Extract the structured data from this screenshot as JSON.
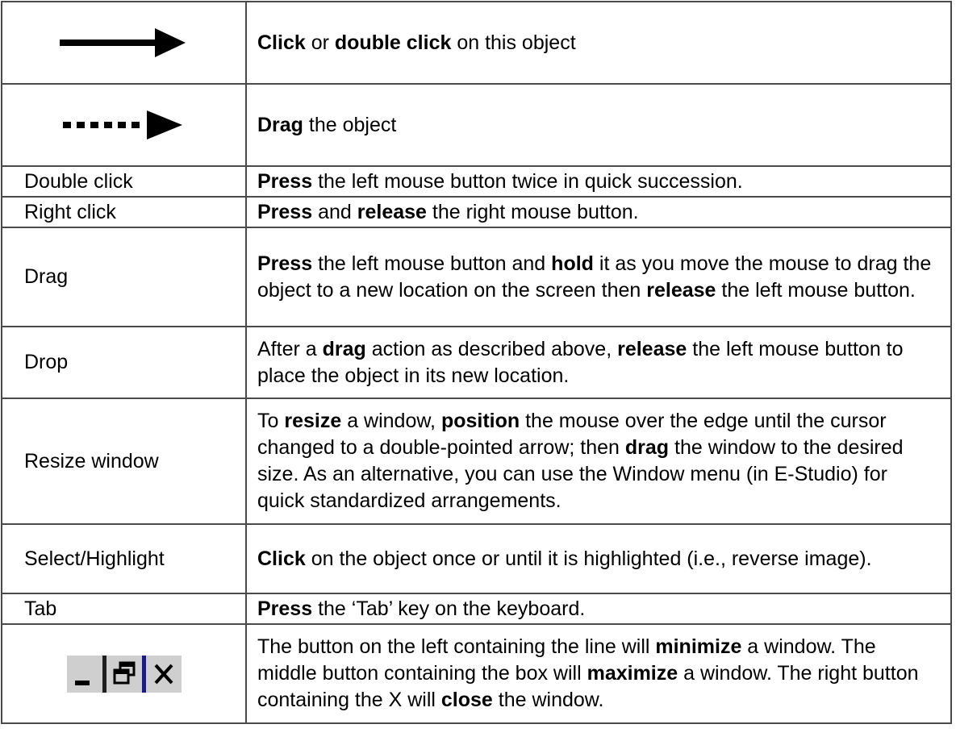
{
  "rows": [
    {
      "term_icon": "solid-arrow-icon",
      "description": [
        {
          "text": "Click",
          "bold": true
        },
        {
          "text": " or ",
          "bold": false
        },
        {
          "text": "double click",
          "bold": true
        },
        {
          "text": " on this object",
          "bold": false
        }
      ]
    },
    {
      "term_icon": "dotted-arrow-icon",
      "description": [
        {
          "text": "Drag",
          "bold": true
        },
        {
          "text": " the object",
          "bold": false
        }
      ]
    },
    {
      "term": "Double click",
      "description": [
        {
          "text": "Press",
          "bold": true
        },
        {
          "text": " the left mouse button twice in quick succession.",
          "bold": false
        }
      ]
    },
    {
      "term": "Right click",
      "description": [
        {
          "text": "Press",
          "bold": true
        },
        {
          "text": " and ",
          "bold": false
        },
        {
          "text": "release",
          "bold": true
        },
        {
          "text": " the right mouse button.",
          "bold": false
        }
      ]
    },
    {
      "term": "Drag",
      "description": [
        {
          "text": "Press",
          "bold": true
        },
        {
          "text": " the left mouse button and ",
          "bold": false
        },
        {
          "text": "hold",
          "bold": true
        },
        {
          "text": " it as you move the mouse to drag the object to a new location on the screen then ",
          "bold": false
        },
        {
          "text": "release",
          "bold": true
        },
        {
          "text": " the left mouse button.",
          "bold": false
        }
      ]
    },
    {
      "term": "Drop",
      "description": [
        {
          "text": "After a ",
          "bold": false
        },
        {
          "text": "drag",
          "bold": true
        },
        {
          "text": " action as described above, ",
          "bold": false
        },
        {
          "text": "release",
          "bold": true
        },
        {
          "text": " the left mouse button to place the object in its new location.",
          "bold": false
        }
      ]
    },
    {
      "term": "Resize window",
      "description": [
        {
          "text": "To ",
          "bold": false
        },
        {
          "text": "resize",
          "bold": true
        },
        {
          "text": " a window, ",
          "bold": false
        },
        {
          "text": "position",
          "bold": true
        },
        {
          "text": " the mouse over the edge until the cursor changed to a double-pointed arrow; then ",
          "bold": false
        },
        {
          "text": "drag",
          "bold": true
        },
        {
          "text": " the window to the desired size. As an alternative, you can use the Window menu (in E-Studio) for quick standardized arrangements.",
          "bold": false
        }
      ]
    },
    {
      "term": "Select/Highlight",
      "description": [
        {
          "text": "Click",
          "bold": true
        },
        {
          "text": " on the object once or until it is highlighted (i.e., reverse image).",
          "bold": false
        }
      ]
    },
    {
      "term": "Tab",
      "description": [
        {
          "text": "Press",
          "bold": true
        },
        {
          "text": " the ‘Tab’ key on the keyboard.",
          "bold": false
        }
      ]
    },
    {
      "term_icon": "window-buttons-icon",
      "description": [
        {
          "text": "The button on the left containing the line will ",
          "bold": false
        },
        {
          "text": "minimize",
          "bold": true
        },
        {
          "text": " a window. The middle button containing the box will ",
          "bold": false
        },
        {
          "text": "maximize",
          "bold": true
        },
        {
          "text": " a window. The right button containing the X will ",
          "bold": false
        },
        {
          "text": "close",
          "bold": true
        },
        {
          "text": " the window.",
          "bold": false
        }
      ]
    }
  ]
}
